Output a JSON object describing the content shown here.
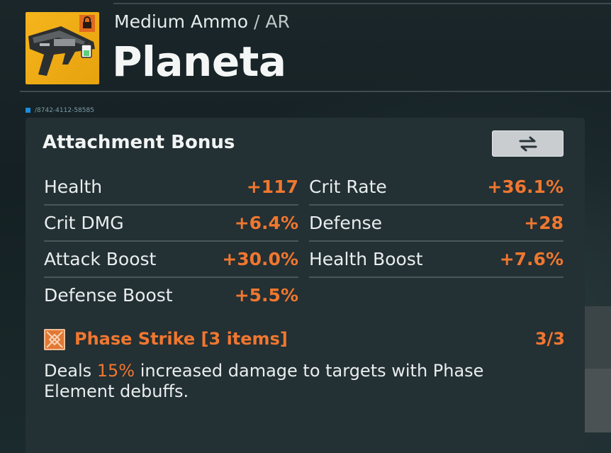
{
  "header": {
    "category": "Medium Ammo",
    "separator": "/",
    "subcategory": "AR",
    "title": "Planeta"
  },
  "serial": "/8742-4112-58585",
  "panel": {
    "title": "Attachment Bonus",
    "swap_icon": "swap-arrows-icon"
  },
  "stats": [
    {
      "label": "Health",
      "value": "+117"
    },
    {
      "label": "Crit Rate",
      "value": "+36.1%"
    },
    {
      "label": "Crit DMG",
      "value": "+6.4%"
    },
    {
      "label": "Defense",
      "value": "+28"
    },
    {
      "label": "Attack Boost",
      "value": "+30.0%"
    },
    {
      "label": "Health Boost",
      "value": "+7.6%"
    },
    {
      "label": "Defense Boost",
      "value": "+5.5%"
    }
  ],
  "set_bonus": {
    "icon": "phase-strike-icon",
    "name": "Phase Strike [3 items]",
    "count": "3/3",
    "desc_prefix": "Deals ",
    "desc_highlight": "15%",
    "desc_suffix": " increased damage to targets with Phase Element debuffs."
  },
  "colors": {
    "accent": "#f0772f",
    "thumb_bg": "#f6b51c",
    "panel_bg": "#233034",
    "serial_dot": "#1c8de0"
  }
}
